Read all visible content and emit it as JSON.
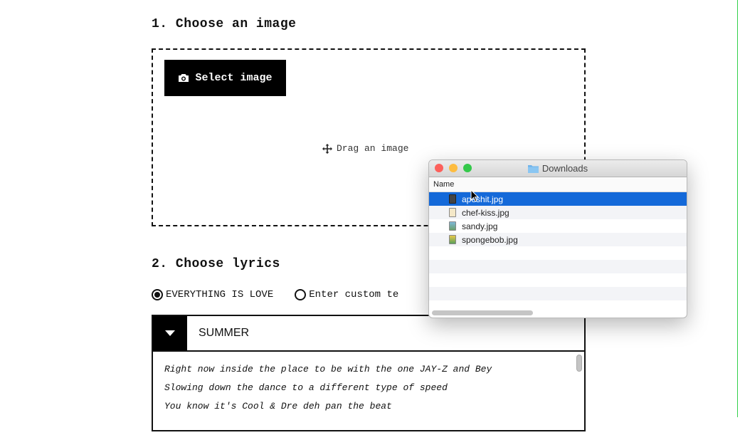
{
  "step1": {
    "heading": "1. Choose an image"
  },
  "dropzone": {
    "select_label": "Select image",
    "drag_label": "Drag an image"
  },
  "step2": {
    "heading": "2. Choose lyrics"
  },
  "lyric_options": [
    {
      "label": "EVERYTHING IS LOVE",
      "selected": true
    },
    {
      "label": "Enter custom te",
      "selected": false
    }
  ],
  "lyrics_panel": {
    "song": "SUMMER",
    "lines": [
      "Right now inside the place to be with the one JAY-Z and Bey",
      "Slowing down the dance to a different type of speed",
      "You know it's Cool & Dre deh pan the beat"
    ]
  },
  "finder": {
    "title": "Downloads",
    "column_name": "Name",
    "files": [
      {
        "name": "apeshit.jpg",
        "selected": true
      },
      {
        "name": "chef-kiss.jpg",
        "selected": false
      },
      {
        "name": "sandy.jpg",
        "selected": false
      },
      {
        "name": "spongebob.jpg",
        "selected": false
      }
    ]
  },
  "colors": {
    "accent_green": "#33d14a",
    "selection_blue": "#1469d9",
    "close": "#fc605b",
    "minimize": "#fdbc40",
    "zoom": "#34c84a"
  },
  "icons": [
    "camera-icon",
    "move-icon",
    "caret-down-icon",
    "folder-icon",
    "image-file-icon",
    "mouse-cursor-icon"
  ]
}
